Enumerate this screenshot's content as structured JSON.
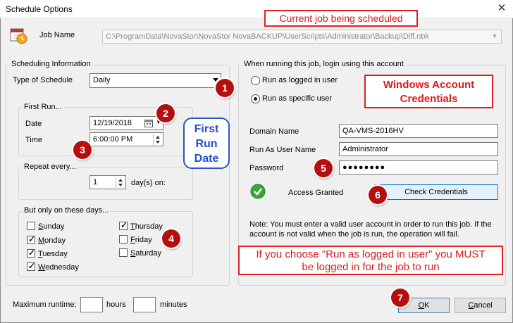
{
  "window": {
    "title": "Schedule Options",
    "close_glyph": "✕"
  },
  "job": {
    "label": "Job Name",
    "path": "C:\\ProgramData\\NovaStor\\NovaStor NovaBACKUP\\UserScripts\\Administrator\\Backup\\Diff.nbk"
  },
  "scheduling": {
    "legend": "Scheduling Information",
    "type_label": "Type of Schedule",
    "type_value": "Daily",
    "first_run": {
      "legend": "First Run...",
      "date_label": "Date",
      "date_value": "12/19/2018",
      "time_label": "Time",
      "time_value": "6:00:00 PM"
    },
    "repeat": {
      "legend": "Repeat every...",
      "value": "1",
      "unit": "day(s) on:"
    },
    "days": {
      "legend": "But only on these days...",
      "items": [
        {
          "label": "Sunday",
          "checked": false
        },
        {
          "label": "Monday",
          "checked": true
        },
        {
          "label": "Tuesday",
          "checked": true
        },
        {
          "label": "Wednesday",
          "checked": true
        },
        {
          "label": "Thursday",
          "checked": true
        },
        {
          "label": "Friday",
          "checked": false
        },
        {
          "label": "Saturday",
          "checked": false
        }
      ]
    }
  },
  "account": {
    "legend": "When running this job, login using this account",
    "radio_logged_in": "Run as logged in user",
    "radio_specific": "Run as specific user",
    "selected": "specific",
    "domain_label": "Domain Name",
    "domain_value": "QA-VMS-2016HV",
    "user_label": "Run As User Name",
    "user_value": "Administrator",
    "password_label": "Password",
    "password_value": "●●●●●●●●",
    "status": "Access Granted",
    "check_button": "Check Credentials",
    "note": "Note: You must enter a valid user account in order to run this job. If the account is not valid when the job is run, the operation will fail."
  },
  "runtime": {
    "label": "Maximum runtime:",
    "hours_label": "hours",
    "minutes_label": "minutes",
    "hours_value": "",
    "minutes_value": ""
  },
  "buttons": {
    "ok": "OK",
    "cancel": "Cancel"
  },
  "annotations": {
    "job_callout": "Current job being scheduled",
    "credentials_callout": "Windows Account Credentials",
    "first_run_callout": "First Run Date",
    "logged_in_callout": "If you choose \"Run as logged in user\" you MUST be logged in for the job to run",
    "badges": [
      "1",
      "2",
      "3",
      "4",
      "5",
      "6",
      "7"
    ]
  },
  "icons": {
    "job": "calendar-clock-icon",
    "status": "green-check-icon",
    "calendar": "calendar-icon"
  },
  "colors": {
    "callout_red": "#d81b1b",
    "badge_red": "#b30f0f",
    "callout_blue": "#1f4fd1",
    "status_green": "#3aa63a"
  }
}
